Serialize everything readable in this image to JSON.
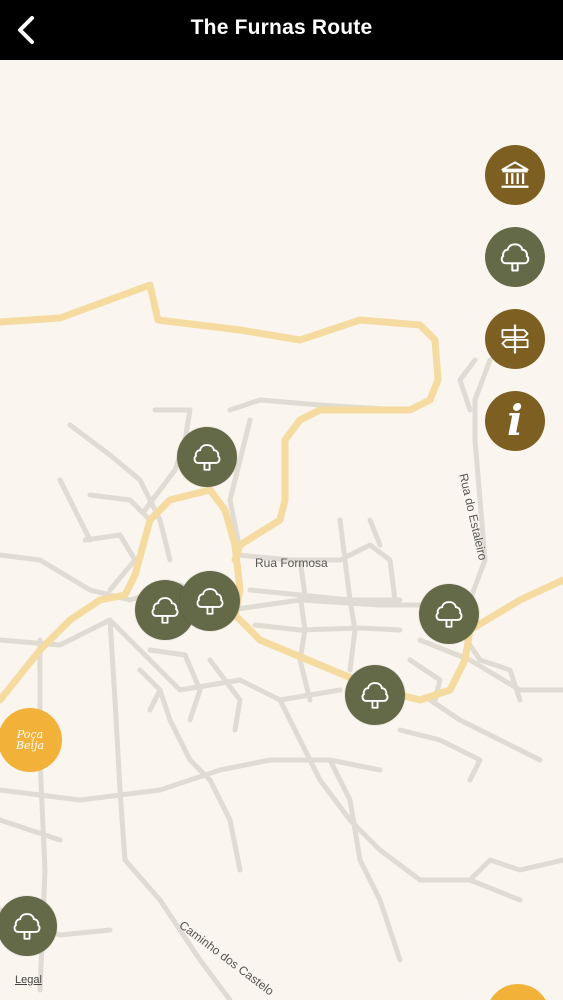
{
  "header": {
    "title": "The Furnas Route",
    "back_icon": "chevron-left-icon"
  },
  "map": {
    "streets": {
      "formosa": "Rua Formosa",
      "estaleiro": "Rua do Estaleiro",
      "castelo": "Caminho dos Castelo"
    },
    "legal": "Legal",
    "poca_label_line1": "Poça",
    "poca_label_line2": "Beija",
    "tree_markers_count": 7
  },
  "side_buttons": [
    {
      "name": "museum",
      "icon": "museum-icon",
      "color": "#7d5f22"
    },
    {
      "name": "nature",
      "icon": "tree-icon",
      "color": "#646a47"
    },
    {
      "name": "trails",
      "icon": "signpost-icon",
      "color": "#7d5f22"
    },
    {
      "name": "info",
      "icon": "info-icon",
      "label": "i",
      "color": "#7d5f22"
    }
  ],
  "colors": {
    "map_bg": "#faf5ee",
    "road_major": "#f5dba0",
    "road_minor": "#e2ddd5",
    "olive": "#646a47",
    "brown": "#7d5f22",
    "amber": "#f2b23a"
  }
}
